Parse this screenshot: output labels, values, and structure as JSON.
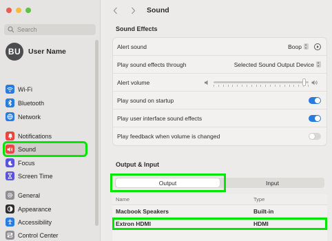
{
  "window": {
    "title": "Sound",
    "traffic_colors": {
      "close": "#ee5b55",
      "minimize": "#f4be3a",
      "zoom": "#5cc443"
    }
  },
  "search": {
    "placeholder": "Search",
    "icon": "magnifier-icon"
  },
  "user": {
    "initials": "BU",
    "name": "User Name"
  },
  "sidebar": {
    "items": [
      {
        "label": "Wi-Fi",
        "icon": "wifi-icon",
        "color": "#2a7bde"
      },
      {
        "label": "Bluetooth",
        "icon": "bluetooth-icon",
        "color": "#2a7bde"
      },
      {
        "label": "Network",
        "icon": "globe-icon",
        "color": "#2a7bde"
      },
      {
        "label": "Notifications",
        "icon": "bell-icon",
        "color": "#e8463f"
      },
      {
        "label": "Sound",
        "icon": "speaker-icon",
        "color": "#e8463f",
        "selected": true
      },
      {
        "label": "Focus",
        "icon": "moon-icon",
        "color": "#5a55d6"
      },
      {
        "label": "Screen Time",
        "icon": "hourglass-icon",
        "color": "#5a55d6"
      },
      {
        "label": "General",
        "icon": "gear-icon",
        "color": "#8e8e93"
      },
      {
        "label": "Appearance",
        "icon": "appearance-icon",
        "color": "#2b2b2b"
      },
      {
        "label": "Accessibility",
        "icon": "accessibility-icon",
        "color": "#2a7bde"
      },
      {
        "label": "Control Center",
        "icon": "control-center-icon",
        "color": "#8e8e93"
      }
    ]
  },
  "sound_effects": {
    "heading": "Sound Effects",
    "alert_sound": {
      "label": "Alert sound",
      "value": "Boop"
    },
    "output_through": {
      "label": "Play sound effects through",
      "value": "Selected Sound Output Device"
    },
    "alert_volume": {
      "label": "Alert volume",
      "level": 0.97
    },
    "startup": {
      "label": "Play sound on startup",
      "on": true
    },
    "ui_effects": {
      "label": "Play user interface sound effects",
      "on": true
    },
    "feedback": {
      "label": "Play feedback when volume is changed",
      "on": false
    }
  },
  "output_input": {
    "heading": "Output & Input",
    "tabs": [
      "Output",
      "Input"
    ],
    "active_tab": "Output",
    "columns": [
      "Name",
      "Type"
    ],
    "devices": [
      {
        "name": "Macbook Speakers",
        "type": "Built-in"
      },
      {
        "name": "Extron HDMI",
        "type": "HDMI",
        "highlighted": true
      }
    ]
  },
  "highlight_color": "#00e600",
  "accent_color": "#2a7bde"
}
